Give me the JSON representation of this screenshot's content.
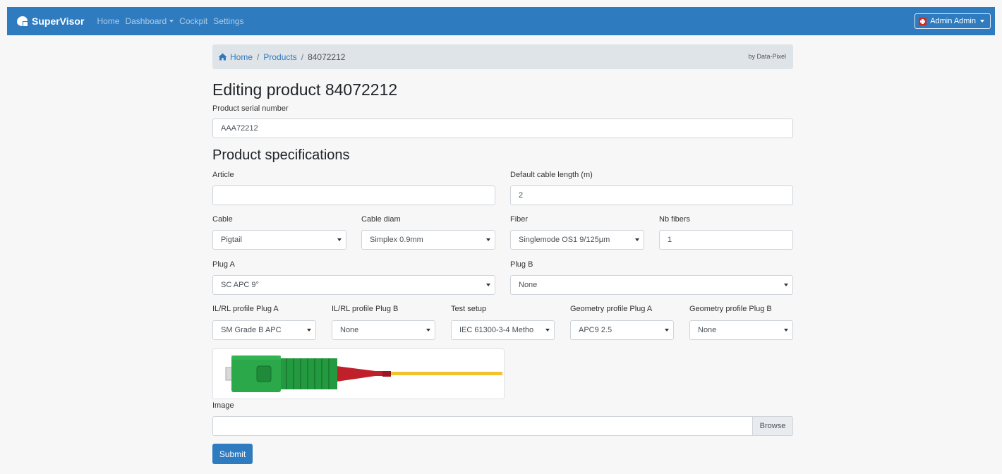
{
  "nav": {
    "brand": "SuperVisor",
    "links": [
      "Home",
      "Dashboard",
      "Cockpit",
      "Settings"
    ],
    "user": "Admin Admin"
  },
  "breadcrumb": {
    "home": "Home",
    "products": "Products",
    "current": "84072212",
    "credit": "by Data-Pixel"
  },
  "page_title": "Editing product 84072212",
  "serial": {
    "label": "Product serial number",
    "value": "AAA72212"
  },
  "specs": {
    "title": "Product specifications",
    "article": {
      "label": "Article",
      "value": ""
    },
    "default_length": {
      "label": "Default cable length (m)",
      "value": "2"
    },
    "cable": {
      "label": "Cable",
      "value": "Pigtail"
    },
    "cable_diam": {
      "label": "Cable diam",
      "value": "Simplex 0.9mm"
    },
    "fiber": {
      "label": "Fiber",
      "value": "Singlemode OS1 9/125µm"
    },
    "nb_fibers": {
      "label": "Nb fibers",
      "value": "1"
    },
    "plug_a": {
      "label": "Plug A",
      "value": "SC APC 9°"
    },
    "plug_b": {
      "label": "Plug B",
      "value": "None"
    },
    "ilrl_a": {
      "label": "IL/RL profile Plug A",
      "value": "SM Grade B APC"
    },
    "ilrl_b": {
      "label": "IL/RL profile Plug B",
      "value": "None"
    },
    "test_setup": {
      "label": "Test setup",
      "value": "IEC 61300-3-4 Metho"
    },
    "geom_a": {
      "label": "Geometry profile Plug A",
      "value": "APC9 2.5"
    },
    "geom_b": {
      "label": "Geometry profile Plug B",
      "value": "None"
    }
  },
  "image": {
    "label": "Image",
    "browse": "Browse"
  },
  "submit": "Submit",
  "colors": {
    "primary": "#2f7bc0",
    "connector_green": "#2aa84a",
    "boot_red": "#c0202a",
    "fiber_yellow": "#f2c230"
  }
}
